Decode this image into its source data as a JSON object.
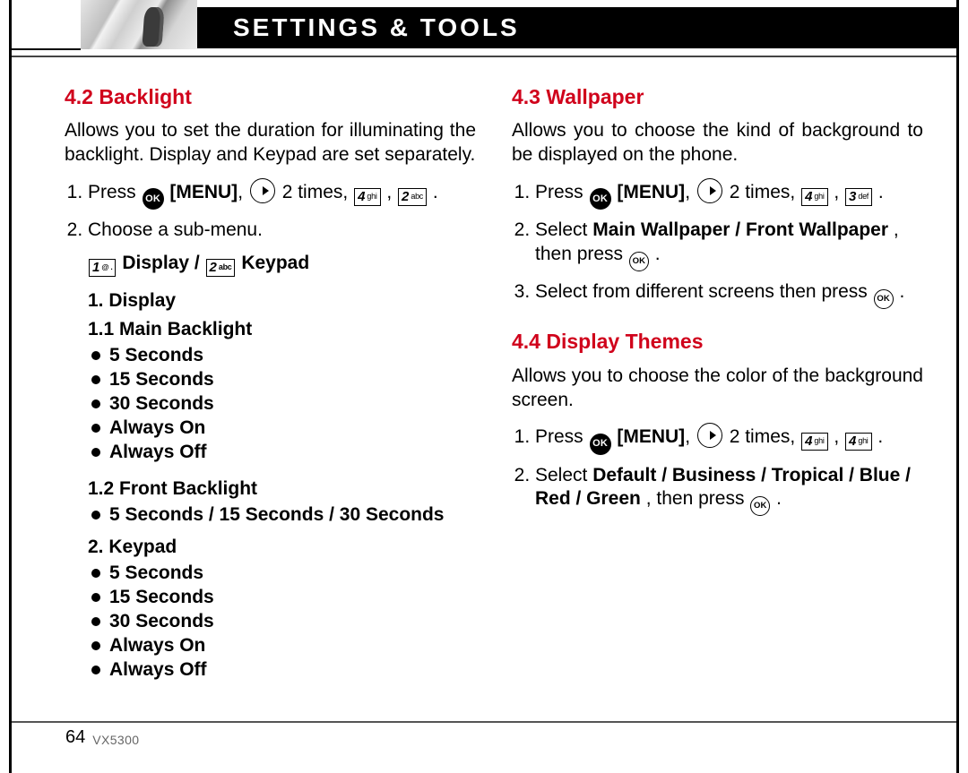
{
  "page": {
    "title": "SETTINGS & TOOLS",
    "number": "64",
    "model": "VX5300"
  },
  "keys": {
    "ok": "OK",
    "ok_small": "OK",
    "one": {
      "num": "1",
      "sub": "@ ."
    },
    "two": {
      "num": "2",
      "sub": "abc"
    },
    "three": {
      "num": "3",
      "sub": "def"
    },
    "four": {
      "num": "4",
      "sub": "ghi"
    }
  },
  "left": {
    "h1": "4.2 Backlight",
    "intro": "Allows you to set the duration for illuminating the backlight. Display and Keypad are set separately.",
    "step1_pre": "Press ",
    "menu_label": "[MENU]",
    "two_times": " 2 times, ",
    "step2": "Choose a sub-menu.",
    "submenu_mid": " Display /  ",
    "submenu_end": " Keypad",
    "display_head": "1. Display",
    "main_backlight": "1.1 Main Backlight",
    "opts": [
      "5 Seconds",
      "15 Seconds",
      "30 Seconds",
      "Always On",
      "Always Off"
    ],
    "front_backlight": "1.2 Front Backlight",
    "front_opts": "5 Seconds / 15 Seconds / 30 Seconds",
    "keypad_head": "2. Keypad",
    "keypad_opts": [
      "5 Seconds",
      "15 Seconds",
      "30 Seconds",
      "Always On",
      "Always Off"
    ]
  },
  "right": {
    "h1": "4.3 Wallpaper",
    "intro": "Allows you to choose the kind of background to be displayed on the phone.",
    "step1_pre": "Press ",
    "menu_label": "[MENU]",
    "two_times": " 2 times, ",
    "step2a": "Select ",
    "step2b": "Main Wallpaper / Front Wallpaper",
    "step2c": ", then press ",
    "step3a": "Select from different screens then press ",
    "h2": "4.4 Display Themes",
    "intro2": "Allows you to choose the color of the background screen.",
    "t_step1_pre": "Press ",
    "t_step2a": "Select ",
    "t_step2b": "Default / Business / Tropical / Blue / Red / Green",
    "t_step2c": ", then press "
  }
}
